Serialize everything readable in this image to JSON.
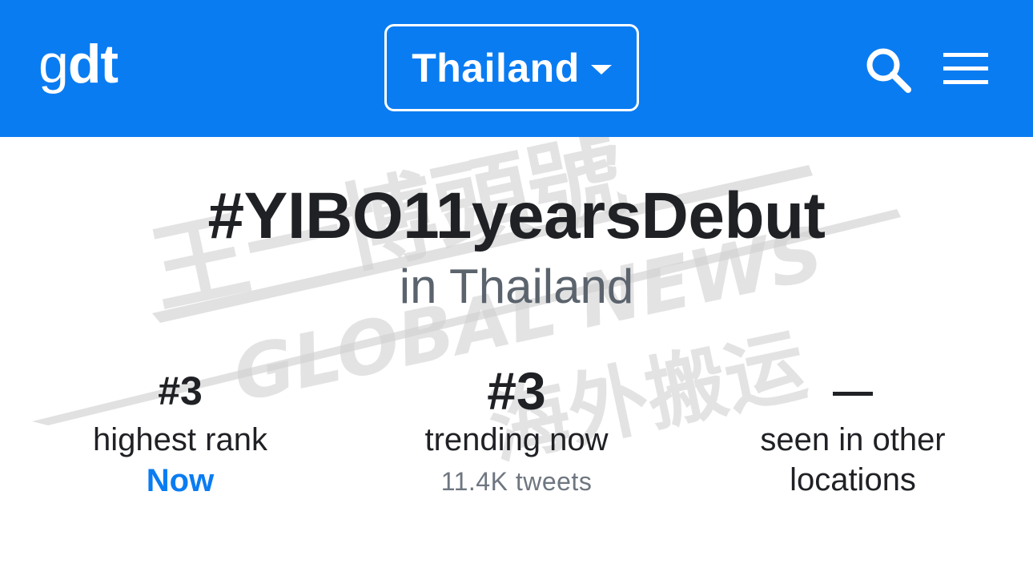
{
  "header": {
    "logo_regular": "g",
    "logo_bold": "dt",
    "country_label": "Thailand",
    "search_icon": "search-icon",
    "menu_icon": "hamburger-menu-icon",
    "background_color": "#0a7cf2"
  },
  "trend": {
    "hashtag": "#YIBO11yearsDebut",
    "location_text": "in Thailand"
  },
  "stats": {
    "highest": {
      "value": "#3",
      "label": "highest rank",
      "sub": "Now"
    },
    "trending": {
      "value": "#3",
      "label": "trending now",
      "sub": "11.4K tweets"
    },
    "other": {
      "value": "—",
      "label_line1": "seen in other",
      "label_line2": "locations"
    }
  },
  "watermark": {
    "cn_top": "王一博頭號",
    "latin": "GLOBAL NEWS",
    "cn_bottom": "海外搬运"
  },
  "colors": {
    "accent": "#0a7cf2",
    "text_dark": "#1f2125",
    "text_gray": "#5b636d"
  }
}
